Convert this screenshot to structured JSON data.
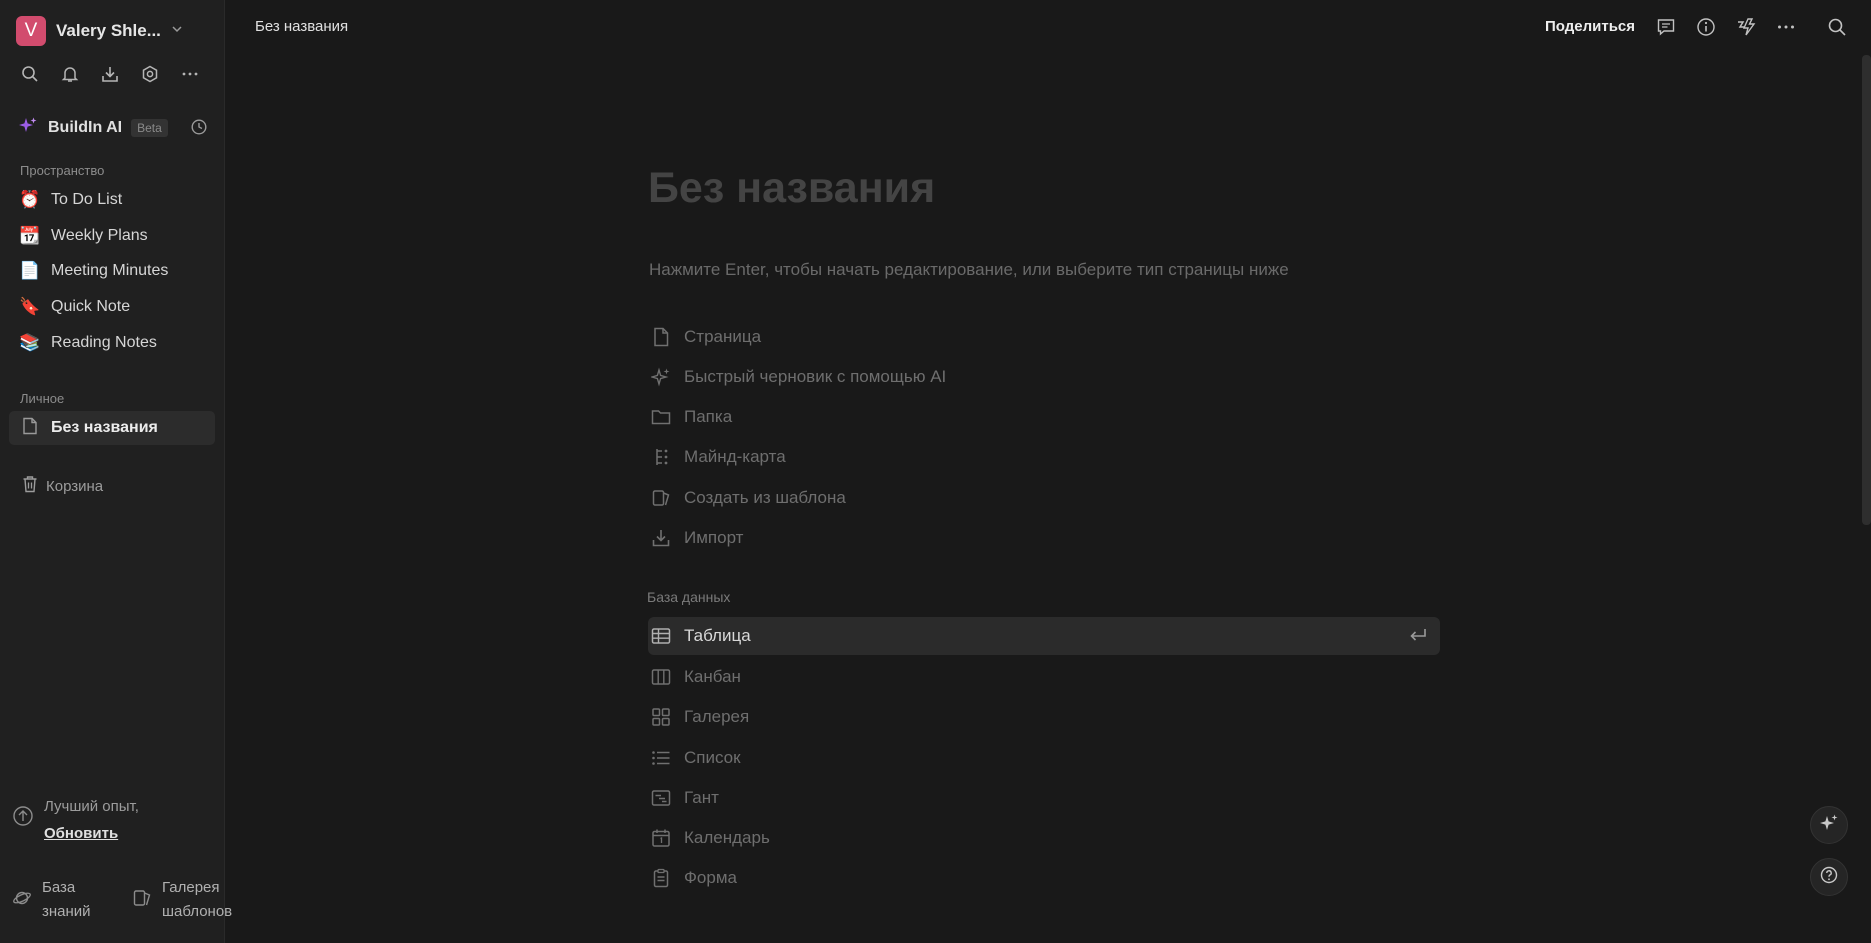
{
  "sidebar": {
    "workspace": {
      "initial": "V",
      "name": "Valery Shle...",
      "avatar_color": "#d24c6e"
    },
    "tools": [
      "search-icon",
      "bell-icon",
      "download-icon",
      "gear-icon",
      "more-icon"
    ],
    "ai": {
      "label": "BuildIn AI",
      "badge": "Beta"
    },
    "space_label": "Пространство",
    "space_items": [
      {
        "emoji": "⏰",
        "label": "To Do List"
      },
      {
        "emoji": "📆",
        "label": "Weekly Plans"
      },
      {
        "emoji": "📄",
        "label": "Meeting Minutes"
      },
      {
        "emoji": "🔖",
        "label": "Quick Note"
      },
      {
        "emoji": "📚",
        "label": "Reading Notes"
      }
    ],
    "personal_label": "Личное",
    "personal_items": [
      {
        "label": "Без названия"
      }
    ],
    "trash_label": "Корзина",
    "upgrade": {
      "text": "Лучший опыт,",
      "link": "Обновить"
    },
    "bottom": {
      "knowledge_line1": "База",
      "knowledge_line2": "знаний",
      "templates_line1": "Галерея",
      "templates_line2": "шаблонов"
    }
  },
  "header": {
    "title": "Без названия",
    "share_label": "Поделиться"
  },
  "main": {
    "page_title": "Без названия",
    "hint": "Нажмите Enter, чтобы начать редактирование, или выберите тип страницы ниже",
    "page_types": [
      {
        "icon": "page-icon",
        "label": "Страница"
      },
      {
        "icon": "sparkle-icon",
        "label": "Быстрый черновик с помощью AI"
      },
      {
        "icon": "folder-icon",
        "label": "Папка"
      },
      {
        "icon": "mindmap-icon",
        "label": "Майнд-карта"
      },
      {
        "icon": "template-icon",
        "label": "Создать из шаблона"
      },
      {
        "icon": "import-icon",
        "label": "Импорт"
      }
    ],
    "database_label": "База данных",
    "database_types": [
      {
        "icon": "table-icon",
        "label": "Таблица",
        "selected": true
      },
      {
        "icon": "kanban-icon",
        "label": "Канбан"
      },
      {
        "icon": "gallery-icon",
        "label": "Галерея"
      },
      {
        "icon": "list-icon",
        "label": "Список"
      },
      {
        "icon": "gantt-icon",
        "label": "Гант"
      },
      {
        "icon": "calendar-icon",
        "label": "Календарь"
      },
      {
        "icon": "form-icon",
        "label": "Форма"
      }
    ]
  },
  "colors": {
    "background": "#191919",
    "sidebar": "#202020",
    "accent": "#d24c6e",
    "ai_sparkle": "#9b5de5"
  }
}
